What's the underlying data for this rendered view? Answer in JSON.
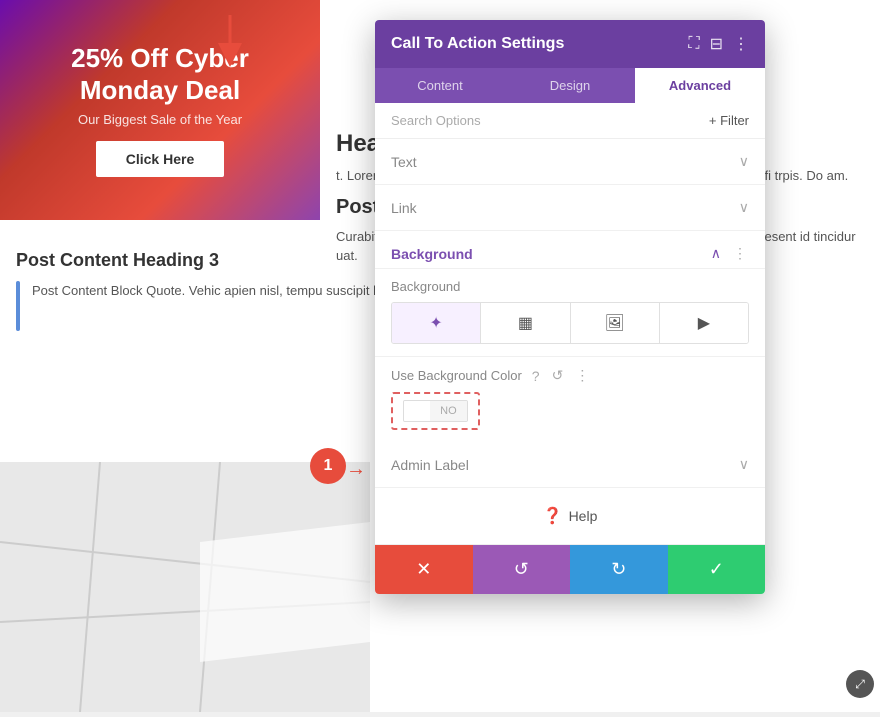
{
  "page": {
    "hero": {
      "title": "25% Off Cyber Monday Deal",
      "subtitle": "Our Biggest Sale of the Year",
      "button_label": "Click Here"
    },
    "content": {
      "heading": "Hea",
      "paragraph1": "t. Lorem ipsum dolor sit amet, consectetur adipiscing elit. Vgue libero, nec fi trpis. Do am.",
      "heading2": "Post Content Headi",
      "paragraph2": "Curabitur a commodo sapien, at pell massa orci, vitae platea dictumst. Praesent id tincidur uat.",
      "heading3": "Post Content Heading 3",
      "blockquote": "Post Content Block Quote. Vehic apien nisl, tempu suscipit lacus. Duis luctus eros d rpis."
    },
    "step_badge": "1"
  },
  "panel": {
    "title": "Call To Action Settings",
    "header_icons": [
      "expand-icon",
      "columns-icon",
      "more-icon"
    ],
    "tabs": [
      {
        "label": "Content",
        "active": false
      },
      {
        "label": "Design",
        "active": false
      },
      {
        "label": "Advanced",
        "active": true
      }
    ],
    "search_placeholder": "Search Options",
    "filter_label": "+ Filter",
    "sections": {
      "text": {
        "label": "Text",
        "expanded": false
      },
      "link": {
        "label": "Link",
        "expanded": false
      },
      "background": {
        "label": "Background",
        "expanded": true,
        "sub_label": "Background",
        "bg_types": [
          {
            "icon": "🎨",
            "type": "color",
            "active": true
          },
          {
            "icon": "🖼",
            "type": "gradient",
            "active": false
          },
          {
            "icon": "📷",
            "type": "image",
            "active": false
          },
          {
            "icon": "🎬",
            "type": "video",
            "active": false
          }
        ],
        "use_bg_color_label": "Use Background Color",
        "toggle_options": [
          {
            "label": "",
            "selected": true
          },
          {
            "label": "NO",
            "selected": false
          }
        ]
      },
      "admin_label": {
        "label": "Admin Label",
        "expanded": false
      }
    },
    "help_label": "Help",
    "actions": {
      "cancel_icon": "✕",
      "undo_icon": "↺",
      "redo_icon": "↻",
      "save_icon": "✓"
    }
  }
}
